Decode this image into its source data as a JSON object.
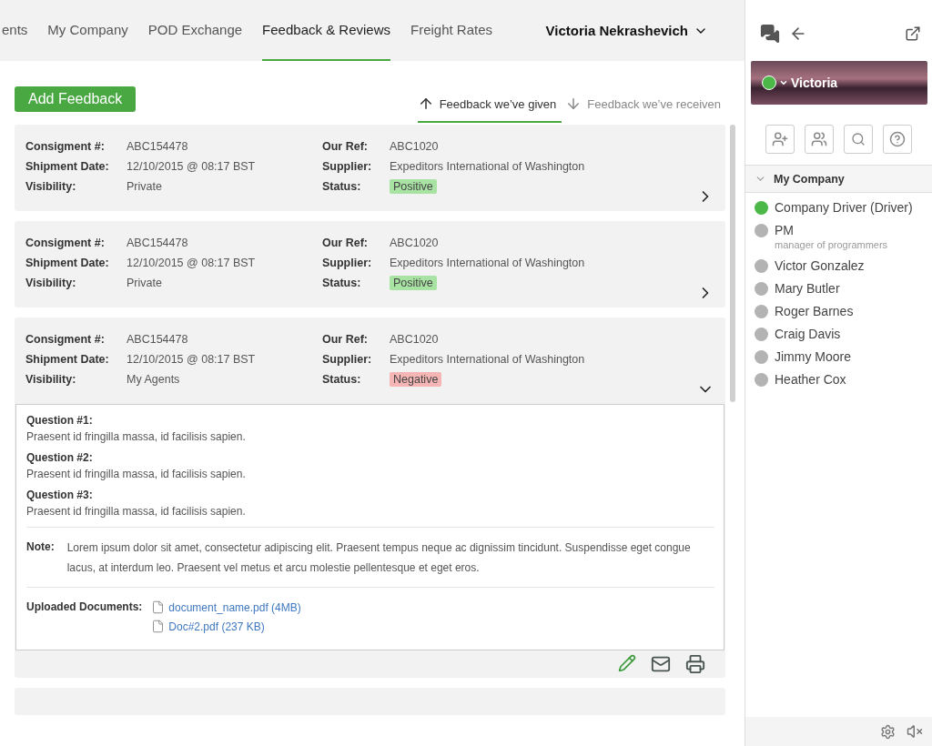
{
  "nav": {
    "items": [
      {
        "label": "ents",
        "selected": false
      },
      {
        "label": "My Company",
        "selected": false
      },
      {
        "label": "POD Exchange",
        "selected": false
      },
      {
        "label": "Feedback & Reviews",
        "selected": true
      },
      {
        "label": "Freight Rates",
        "selected": false
      }
    ],
    "user": "Victoria Nekrashevich"
  },
  "add_button": "Add Feedback",
  "feedback_tabs": [
    {
      "label": "Feedback we’ve given",
      "selected": true,
      "kind": "up"
    },
    {
      "label": "Feedback we’ve receiven",
      "selected": false,
      "kind": "down"
    }
  ],
  "cards": [
    {
      "expanded": false,
      "left": [
        {
          "label": "Consigment #:",
          "value": "ABC154478"
        },
        {
          "label": "Shipment Date:",
          "value": "12/10/2015 @ 08:17 BST"
        },
        {
          "label": "Visibility:",
          "value": "Private"
        }
      ],
      "right": [
        {
          "label": "Our Ref:",
          "value": "ABC1020"
        },
        {
          "label": "Supplier:",
          "value": "Expeditors International of Washington"
        }
      ],
      "status_label": "Status:",
      "status": {
        "text": "Positive",
        "kind": "positive"
      }
    },
    {
      "expanded": false,
      "left": [
        {
          "label": "Consigment #:",
          "value": "ABC154478"
        },
        {
          "label": "Shipment Date:",
          "value": "12/10/2015 @ 08:17 BST"
        },
        {
          "label": "Visibility:",
          "value": "Private"
        }
      ],
      "right": [
        {
          "label": "Our Ref:",
          "value": "ABC1020"
        },
        {
          "label": "Supplier:",
          "value": "Expeditors International of Washington"
        }
      ],
      "status_label": "Status:",
      "status": {
        "text": "Positive",
        "kind": "positive"
      }
    },
    {
      "expanded": true,
      "left": [
        {
          "label": "Consigment #:",
          "value": "ABC154478"
        },
        {
          "label": "Shipment Date:",
          "value": "12/10/2015 @ 08:17 BST"
        },
        {
          "label": "Visibility:",
          "value": "My Agents"
        }
      ],
      "right": [
        {
          "label": "Our Ref:",
          "value": "ABC1020"
        },
        {
          "label": "Supplier:",
          "value": "Expeditors International of Washington"
        }
      ],
      "status_label": "Status:",
      "status": {
        "text": "Negative",
        "kind": "negative"
      },
      "details": {
        "questions": [
          {
            "label": "Question #1:",
            "answer": "Praesent id fringilla massa, id facilisis sapien."
          },
          {
            "label": "Question #2:",
            "answer": "Praesent id fringilla massa, id facilisis sapien."
          },
          {
            "label": "Question #3:",
            "answer": "Praesent id fringilla massa, id facilisis sapien."
          }
        ],
        "note_label": "Note:",
        "note": "Lorem ipsum dolor sit amet, consectetur adipiscing elit. Praesent tempus neque ac dignissim tincidunt. Suspendisse eget congue lacus, at interdum leo. Praesent vel metus et arcu molestie pellentesque et eget eros.",
        "documents_label": "Uploaded Documents:",
        "documents": [
          "document_name.pdf (4MB)",
          "Doc#2.pdf (237 KB)"
        ]
      }
    }
  ],
  "sidebar": {
    "profile": {
      "name": "Victoria",
      "online": true
    },
    "group": {
      "label": "My Company",
      "expanded": true
    },
    "contacts": [
      {
        "name": "Company Driver (Driver)",
        "color": "#4cb848"
      },
      {
        "name": "PM",
        "subtitle": "manager of programmers",
        "color": "#b3b3b3"
      },
      {
        "name": "Victor Gonzalez",
        "color": "#b3b3b3"
      },
      {
        "name": "Mary Butler",
        "color": "#b3b3b3"
      },
      {
        "name": "Roger Barnes",
        "color": "#b3b3b3"
      },
      {
        "name": "Craig Davis",
        "color": "#b3b3b3"
      },
      {
        "name": "Jimmy Moore",
        "color": "#b3b3b3"
      },
      {
        "name": "Heather Cox",
        "color": "#b3b3b3"
      }
    ]
  }
}
